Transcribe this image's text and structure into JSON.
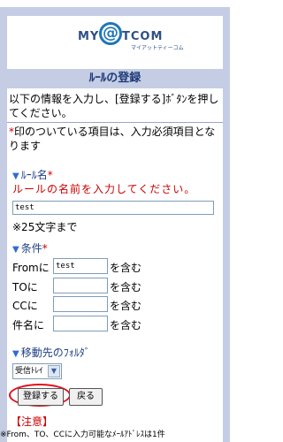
{
  "logo": {
    "part1": "MY",
    "at": "@",
    "part2": "TCOM",
    "sub": "マイアットティーコム"
  },
  "page_title": "ﾙｰﾙの登録",
  "intro": "以下の情報を入力し、[登録する]ﾎﾞﾀﾝを押してください。",
  "required_note": "印のついている項目は、入力必須項目となります",
  "required_mark": "*",
  "rule_name": {
    "label": "ﾙｰﾙ名",
    "prompt": "ルールの名前を入力してください。",
    "value": "test",
    "limit_note": "※25文字まで"
  },
  "conditions": {
    "label": "条件",
    "rows": [
      {
        "label": "Fromに",
        "value": "test",
        "suffix": "を含む"
      },
      {
        "label": "TOに",
        "value": "",
        "suffix": "を含む"
      },
      {
        "label": "CCに",
        "value": "",
        "suffix": "を含む"
      },
      {
        "label": "件名に",
        "value": "",
        "suffix": "を含む"
      }
    ]
  },
  "folder": {
    "label": "移動先のﾌｫﾙﾀﾞ",
    "selected": "受信ﾄﾚｲ"
  },
  "buttons": {
    "submit": "登録する",
    "back": "戻る"
  },
  "caution": "【注意】",
  "footer": "※From、TO、CCに入力可能なﾒｰﾙｱﾄﾞﾚｽは1件"
}
